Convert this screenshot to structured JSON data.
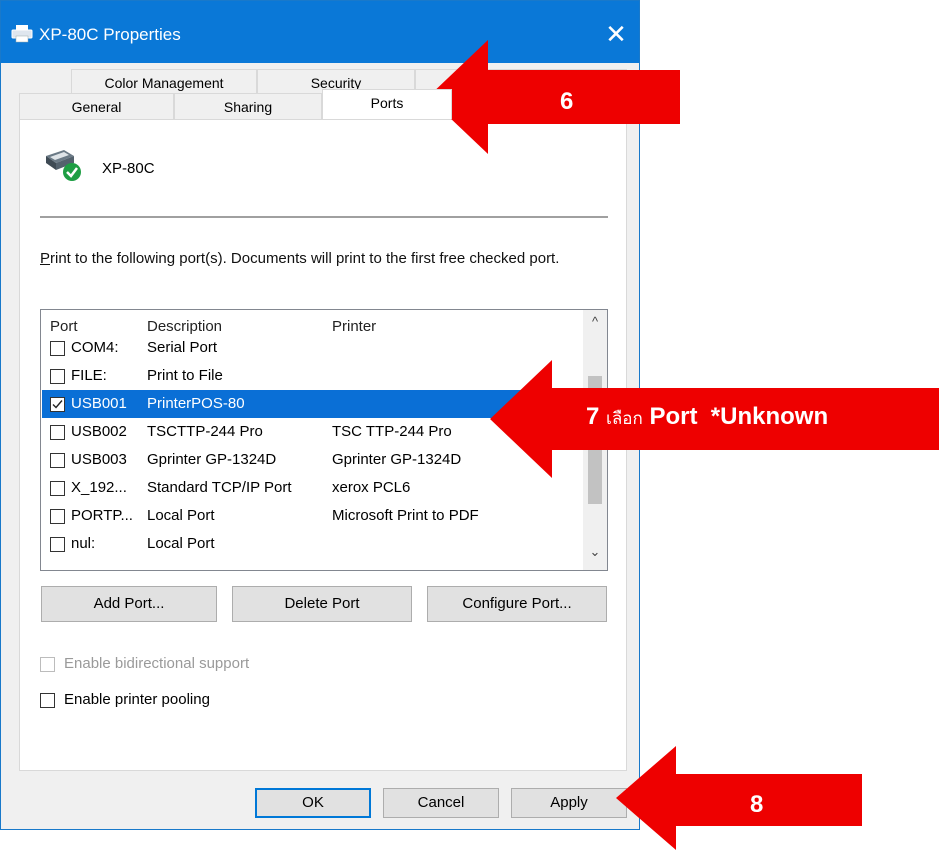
{
  "window": {
    "title": "XP-80C Properties",
    "close_glyph": "✕"
  },
  "tabs": {
    "row1": [
      "Color Management",
      "Security",
      ""
    ],
    "row2": [
      "General",
      "Sharing",
      "Ports"
    ]
  },
  "printer": {
    "name": "XP-80C"
  },
  "description": {
    "p_letter": "P",
    "rest": "rint to the following port(s). Documents will print to the first free checked port."
  },
  "port_list": {
    "headers": [
      "Port",
      "Description",
      "Printer"
    ],
    "rows": [
      {
        "port": "COM4:",
        "description": "Serial Port",
        "printer": "",
        "checked": false,
        "selected": false
      },
      {
        "port": "FILE:",
        "description": "Print to File",
        "printer": "",
        "checked": false,
        "selected": false
      },
      {
        "port": "USB001",
        "description": "PrinterPOS-80",
        "printer": "",
        "checked": true,
        "selected": true
      },
      {
        "port": "USB002",
        "description": "TSCTTP-244 Pro",
        "printer": "TSC TTP-244 Pro",
        "checked": false,
        "selected": false
      },
      {
        "port": "USB003",
        "description": "Gprinter GP-1324D",
        "printer": "Gprinter GP-1324D",
        "checked": false,
        "selected": false
      },
      {
        "port": "X_192...",
        "description": "Standard TCP/IP Port",
        "printer": "xerox PCL6",
        "checked": false,
        "selected": false
      },
      {
        "port": "PORTP...",
        "description": "Local Port",
        "printer": "Microsoft Print to PDF",
        "checked": false,
        "selected": false
      },
      {
        "port": "nul:",
        "description": "Local Port",
        "printer": "",
        "checked": false,
        "selected": false
      }
    ],
    "scroll_up": "^",
    "scroll_down": "⌄"
  },
  "buttons": {
    "add_port": "Add Port...",
    "delete_port": "Delete Port",
    "configure_port": "Configure Port...",
    "ok": "OK",
    "cancel": "Cancel",
    "apply": "Apply"
  },
  "options": {
    "bidirectional": {
      "label": "Enable bidirectional support",
      "checked": false,
      "enabled": false
    },
    "pooling": {
      "label": "Enable printer pooling",
      "checked": false,
      "enabled": true
    }
  },
  "annotations": {
    "step6": "6",
    "step7_num": "7",
    "step7_thai": "เลือก",
    "step7_text": "Port  *Unknown",
    "step8": "8",
    "arrow_color": "#ee0000"
  },
  "colors": {
    "titlebar": "#0a78d7",
    "selection": "#0a6fd6",
    "default_button_border": "#0078d7"
  }
}
